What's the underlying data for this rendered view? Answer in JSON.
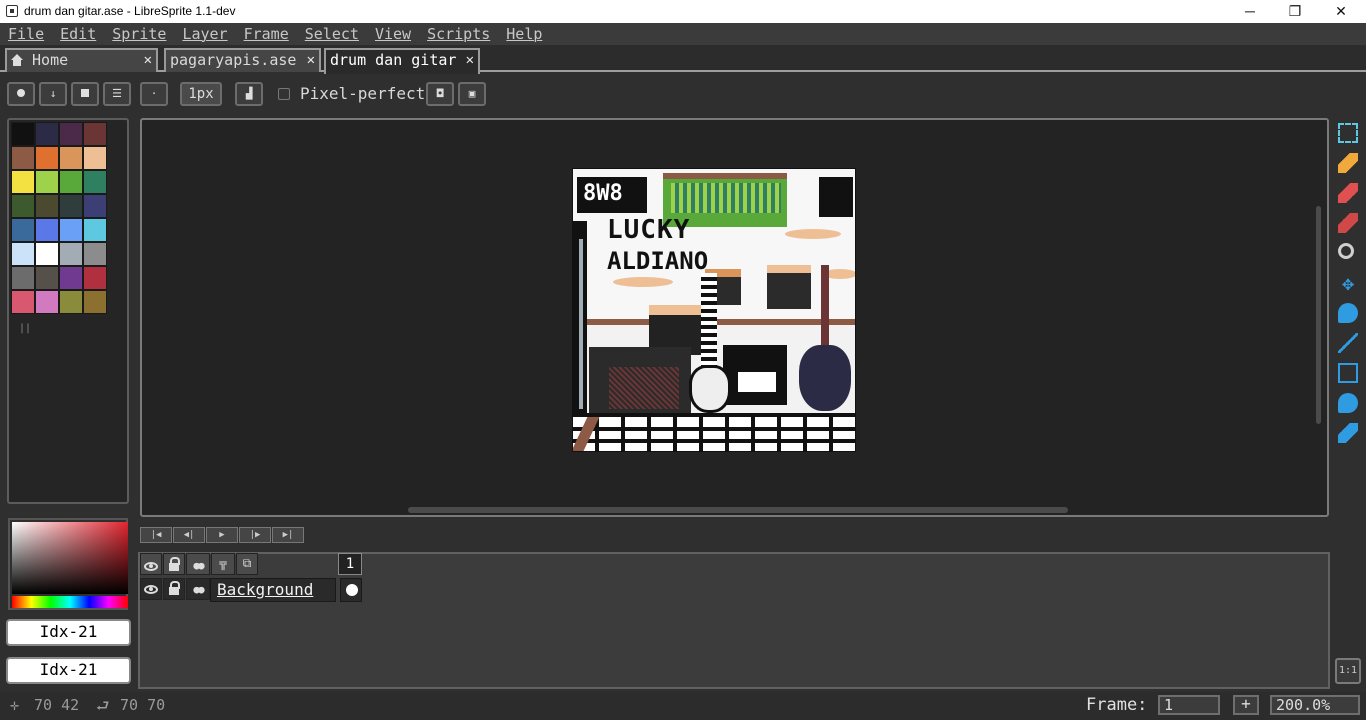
{
  "window": {
    "title": "drum dan gitar.ase - LibreSprite 1.1-dev",
    "minimize": "─",
    "maximize": "❐",
    "close": "✕"
  },
  "menu": [
    "File",
    "Edit",
    "Sprite",
    "Layer",
    "Frame",
    "Select",
    "View",
    "Scripts",
    "Help"
  ],
  "tabs": [
    {
      "label": "Home",
      "active": false
    },
    {
      "label": "pagaryapis.ase",
      "active": false
    },
    {
      "label": "drum dan gitar",
      "active": true
    }
  ],
  "context_bar": {
    "brush_size": "1px",
    "pixel_perfect_label": "Pixel-perfect",
    "pixel_perfect_checked": false
  },
  "palette": [
    "#111111",
    "#2b2b45",
    "#4a2a48",
    "#6b3535",
    "#8c5a45",
    "#e07030",
    "#d9955a",
    "#eebf95",
    "#f2e140",
    "#9ed24a",
    "#58a83a",
    "#2f8060",
    "#3d5a2f",
    "#4b4a30",
    "#2f3d3c",
    "#3b3f73",
    "#3a6a9b",
    "#5a78e8",
    "#6aa0f5",
    "#5dc8e0",
    "#cce2f8",
    "#ffffff",
    "#a2acb4",
    "#8c8c8c",
    "#6c6c6c",
    "#55504a",
    "#703a90",
    "#b03040",
    "#d85870",
    "#d27ac0",
    "#8b8b3c",
    "#8b7030"
  ],
  "color_indices": {
    "foreground": "Idx-21",
    "background": "Idx-21"
  },
  "sprite_text": {
    "line1": "LUCKY",
    "line2": "ALDIANO",
    "badge": "8W8"
  },
  "timeline": {
    "frame_number": "1",
    "layers": [
      {
        "name": "Background"
      }
    ]
  },
  "status": {
    "cursor_pos": "70 42",
    "selection_size": "70 70",
    "frame_label": "Frame:",
    "frame_value": "1",
    "plus": "+",
    "zoom": "200.0%",
    "ratio": "1:1"
  },
  "tools": [
    "rectangular-marquee",
    "pencil",
    "eraser",
    "eyedropper",
    "zoom",
    "move",
    "paint-bucket",
    "line",
    "rectangle",
    "contour",
    "blur"
  ]
}
